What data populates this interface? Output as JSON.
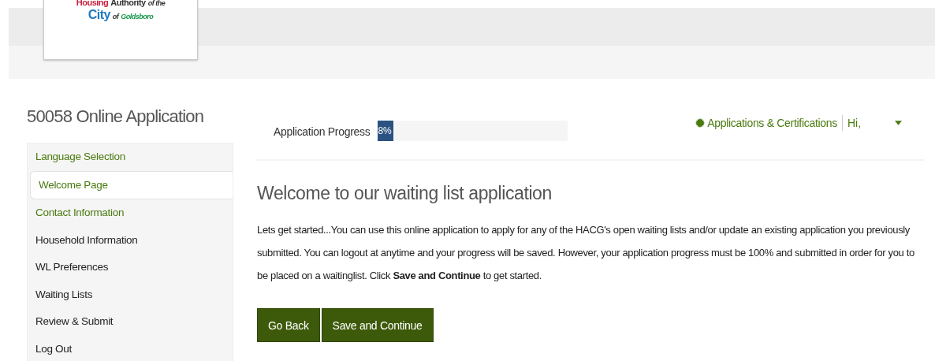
{
  "logo": {
    "lines": [
      [
        {
          "text": "Housing",
          "color": "#c8203f"
        },
        {
          "text": "Authority",
          "color": "#333333"
        },
        {
          "text": "of the",
          "color": "#333333"
        }
      ],
      [
        {
          "text": "City",
          "color": "#1f7bc1"
        },
        {
          "text": "of",
          "color": "#333333"
        },
        {
          "text": "Goldsboro",
          "color": "#149447"
        }
      ]
    ]
  },
  "sidebar": {
    "title": "50058 Online Application",
    "items": [
      {
        "label": "Language Selection",
        "selected": false,
        "completed": true
      },
      {
        "label": "Welcome Page",
        "selected": true,
        "completed": true
      },
      {
        "label": "Contact Information",
        "selected": false,
        "completed": true
      },
      {
        "label": "Household Information",
        "selected": false,
        "completed": false
      },
      {
        "label": "WL Preferences",
        "selected": false,
        "completed": false
      },
      {
        "label": "Waiting Lists",
        "selected": false,
        "completed": false
      },
      {
        "label": "Review & Submit",
        "selected": false,
        "completed": false
      },
      {
        "label": "Log Out",
        "selected": false,
        "completed": false
      }
    ]
  },
  "progress": {
    "label": "Application Progress",
    "level": 0.08,
    "reading": "8%"
  },
  "nav": {
    "link": "Applications & Certifications",
    "greeting": "Hi,"
  },
  "heading": "Welcome to our waiting list application",
  "paragraph": "Lets get started...You can use this online application to apply for any of the HACG's open waiting lists and/or update an existing application you previously submitted. You can logout at anytime and your progress will be saved. However, your application progress must be 100% and submitted in order for you to be placed on a waitinglist. Click **Save and Continue** to get started.",
  "buttons": [
    "Go Back",
    "Save and Continue"
  ]
}
